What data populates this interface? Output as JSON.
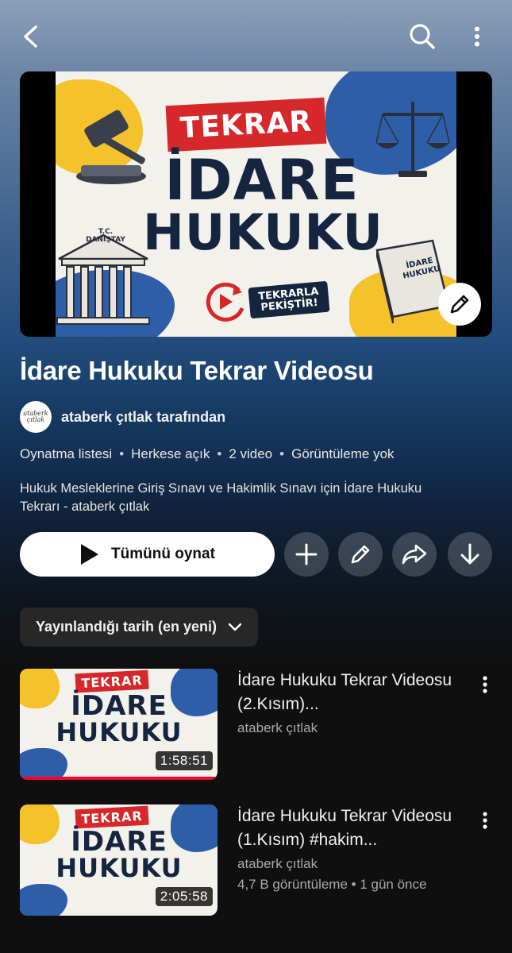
{
  "topbar": {
    "back_icon": "chevron-left-icon",
    "search_icon": "search-icon",
    "more_icon": "more-vertical-icon"
  },
  "hero": {
    "tag": "TEKRAR",
    "line1": "İDARE",
    "line2": "HUKUKU",
    "badge_text": "TEKRARLA PEKİŞTİR!",
    "building_label": "T.C. DANIŞTAY",
    "book_label": "İDARE HUKUKU",
    "edit_icon": "pencil-icon"
  },
  "playlist": {
    "title": "İdare Hukuku Tekrar Videosu",
    "avatar_text": "ataberk çıtlak",
    "owner": "ataberk çıtlak tarafından",
    "meta": [
      "Oynatma listesi",
      "Herkese açık",
      "2 video",
      "Görüntüleme yok"
    ],
    "description": "Hukuk Mesleklerine Giriş Sınavı ve Hakimlik Sınavı için İdare Hukuku Tekrarı - ataberk çıtlak"
  },
  "actions": {
    "play_all": "Tümünü oynat",
    "buttons": [
      "plus-icon",
      "pencil-icon",
      "share-icon",
      "download-icon"
    ]
  },
  "sort": {
    "label": "Yayınlandığı tarih (en yeni)"
  },
  "videos": [
    {
      "title": "İdare Hukuku Tekrar Videosu (2.Kısım)...",
      "channel": "ataberk çıtlak",
      "stats": "",
      "duration": "1:58:51",
      "watched_fraction": 1.0
    },
    {
      "title": "İdare Hukuku Tekrar Videosu (1.Kısım) #hakim...",
      "channel": "ataberk çıtlak",
      "stats": "4,7 B görüntüleme • 1 gün önce",
      "duration": "2:05:58",
      "watched_fraction": 0
    }
  ],
  "colors": {
    "accent": "#ff0033",
    "navy": "#15253f",
    "red_tag": "#d6282b",
    "yellow": "#f4c22b",
    "blue": "#2f5ea8"
  }
}
